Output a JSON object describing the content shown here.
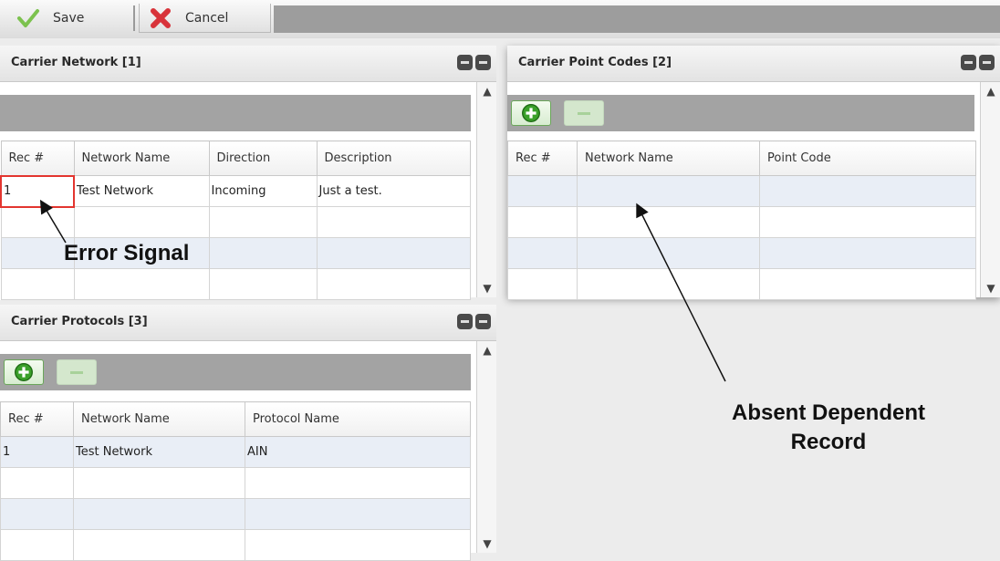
{
  "toolbar": {
    "save_label": "Save",
    "cancel_label": "Cancel"
  },
  "carrier_network": {
    "title": "Carrier Network [1]",
    "columns": [
      "Rec #",
      "Network Name",
      "Direction",
      "Description"
    ],
    "rows": [
      [
        "1",
        "Test Network",
        "Incoming",
        "Just a test."
      ],
      [
        "",
        "",
        "",
        ""
      ],
      [
        "",
        "",
        "",
        ""
      ],
      [
        "",
        "",
        "",
        ""
      ]
    ]
  },
  "carrier_point_codes": {
    "title": "Carrier Point Codes [2]",
    "columns": [
      "Rec #",
      "Network Name",
      "Point Code"
    ],
    "rows": [
      [
        "",
        "",
        ""
      ],
      [
        "",
        "",
        ""
      ],
      [
        "",
        "",
        ""
      ],
      [
        "",
        "",
        ""
      ]
    ]
  },
  "carrier_protocols": {
    "title": "Carrier Protocols [3]",
    "columns": [
      "Rec #",
      "Network Name",
      "Protocol Name"
    ],
    "rows": [
      [
        "1",
        "Test Network",
        "AIN"
      ],
      [
        "",
        "",
        ""
      ],
      [
        "",
        "",
        ""
      ],
      [
        "",
        "",
        ""
      ]
    ]
  },
  "annotations": {
    "error_signal": "Error Signal",
    "absent_line1": "Absent Dependent",
    "absent_line2": "Record"
  },
  "icons": {
    "save": "checkmark-icon",
    "cancel": "x-icon",
    "add": "plus-icon",
    "remove": "minus-icon"
  },
  "colors": {
    "error_border": "#e3352f",
    "add_green": "#3aa02a",
    "cancel_red": "#d8333a"
  }
}
